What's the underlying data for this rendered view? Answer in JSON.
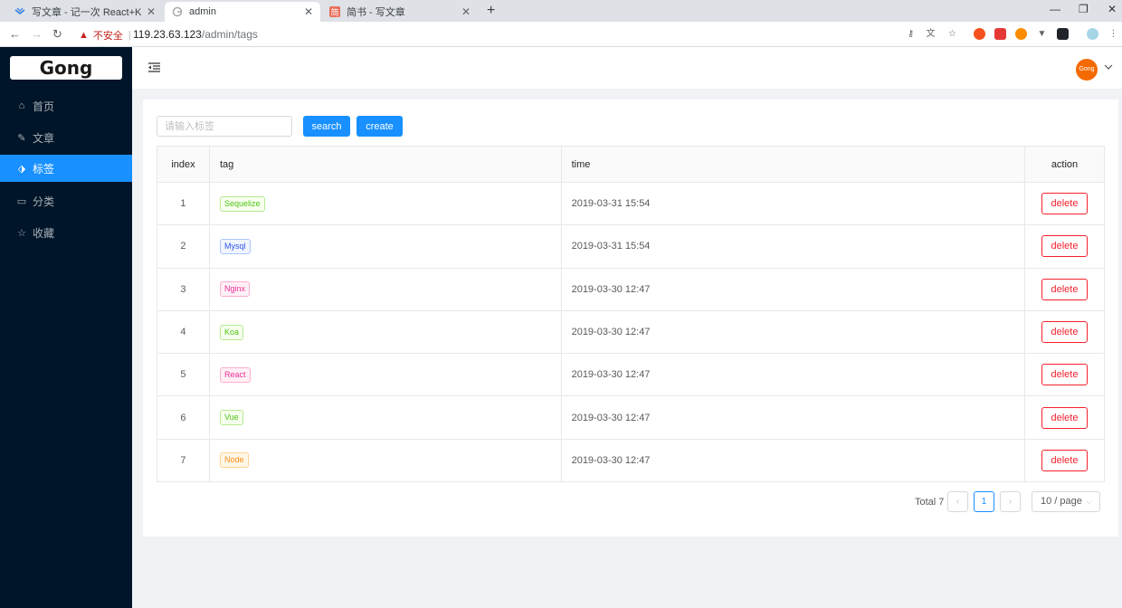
{
  "browser": {
    "tabs": [
      {
        "title": "写文章 - 记一次 React+Koa + M",
        "icon": "wind-icon"
      },
      {
        "title": "admin",
        "icon": "google-icon"
      },
      {
        "title": "简书 - 写文章",
        "icon": "jianshu-icon",
        "favicon_text": "简"
      }
    ],
    "security_label": "不安全",
    "url_host": "119.23.63.123",
    "url_path": "/admin/tags"
  },
  "sidebar": {
    "logo": "Gong",
    "items": [
      {
        "label": "首页",
        "icon": "home-icon"
      },
      {
        "label": "文章",
        "icon": "edit-icon"
      },
      {
        "label": "标签",
        "icon": "tag-icon"
      },
      {
        "label": "分类",
        "icon": "folder-icon"
      },
      {
        "label": "收藏",
        "icon": "star-icon"
      }
    ],
    "active_index": 2
  },
  "header": {
    "avatar_text": "Gong",
    "avatar_color": "#f56a00"
  },
  "toolbar": {
    "search_placeholder": "请输入标签",
    "search_value": "",
    "search_label": "search",
    "create_label": "create"
  },
  "table": {
    "headers": {
      "index": "index",
      "tag": "tag",
      "time": "time",
      "action": "action"
    },
    "rows": [
      {
        "index": "1",
        "tag": "Sequelize",
        "tag_color": "#52c41a",
        "tag_bg": "#f6ffed",
        "tag_border": "#b7eb8f",
        "time": "2019-03-31 15:54",
        "action": "delete"
      },
      {
        "index": "2",
        "tag": "Mysql",
        "tag_color": "#2f54eb",
        "tag_bg": "#f0f5ff",
        "tag_border": "#adc6ff",
        "time": "2019-03-31 15:54",
        "action": "delete"
      },
      {
        "index": "3",
        "tag": "Nginx",
        "tag_color": "#eb2f96",
        "tag_bg": "#fff0f6",
        "tag_border": "#ffadd2",
        "time": "2019-03-30 12:47",
        "action": "delete"
      },
      {
        "index": "4",
        "tag": "Koa",
        "tag_color": "#52c41a",
        "tag_bg": "#f6ffed",
        "tag_border": "#b7eb8f",
        "time": "2019-03-30 12:47",
        "action": "delete"
      },
      {
        "index": "5",
        "tag": "React",
        "tag_color": "#eb2f96",
        "tag_bg": "#fff0f6",
        "tag_border": "#ffadd2",
        "time": "2019-03-30 12:47",
        "action": "delete"
      },
      {
        "index": "6",
        "tag": "Vue",
        "tag_color": "#52c41a",
        "tag_bg": "#f6ffed",
        "tag_border": "#b7eb8f",
        "time": "2019-03-30 12:47",
        "action": "delete"
      },
      {
        "index": "7",
        "tag": "Node",
        "tag_color": "#fa8c16",
        "tag_bg": "#fff7e6",
        "tag_border": "#ffd591",
        "time": "2019-03-30 12:47",
        "action": "delete"
      }
    ]
  },
  "pagination": {
    "total_label": "Total 7",
    "current_page": "1",
    "page_size": "10 / page"
  },
  "colors": {
    "primary": "#1890ff",
    "sidebar_bg": "#001529",
    "danger": "#f5222d"
  }
}
